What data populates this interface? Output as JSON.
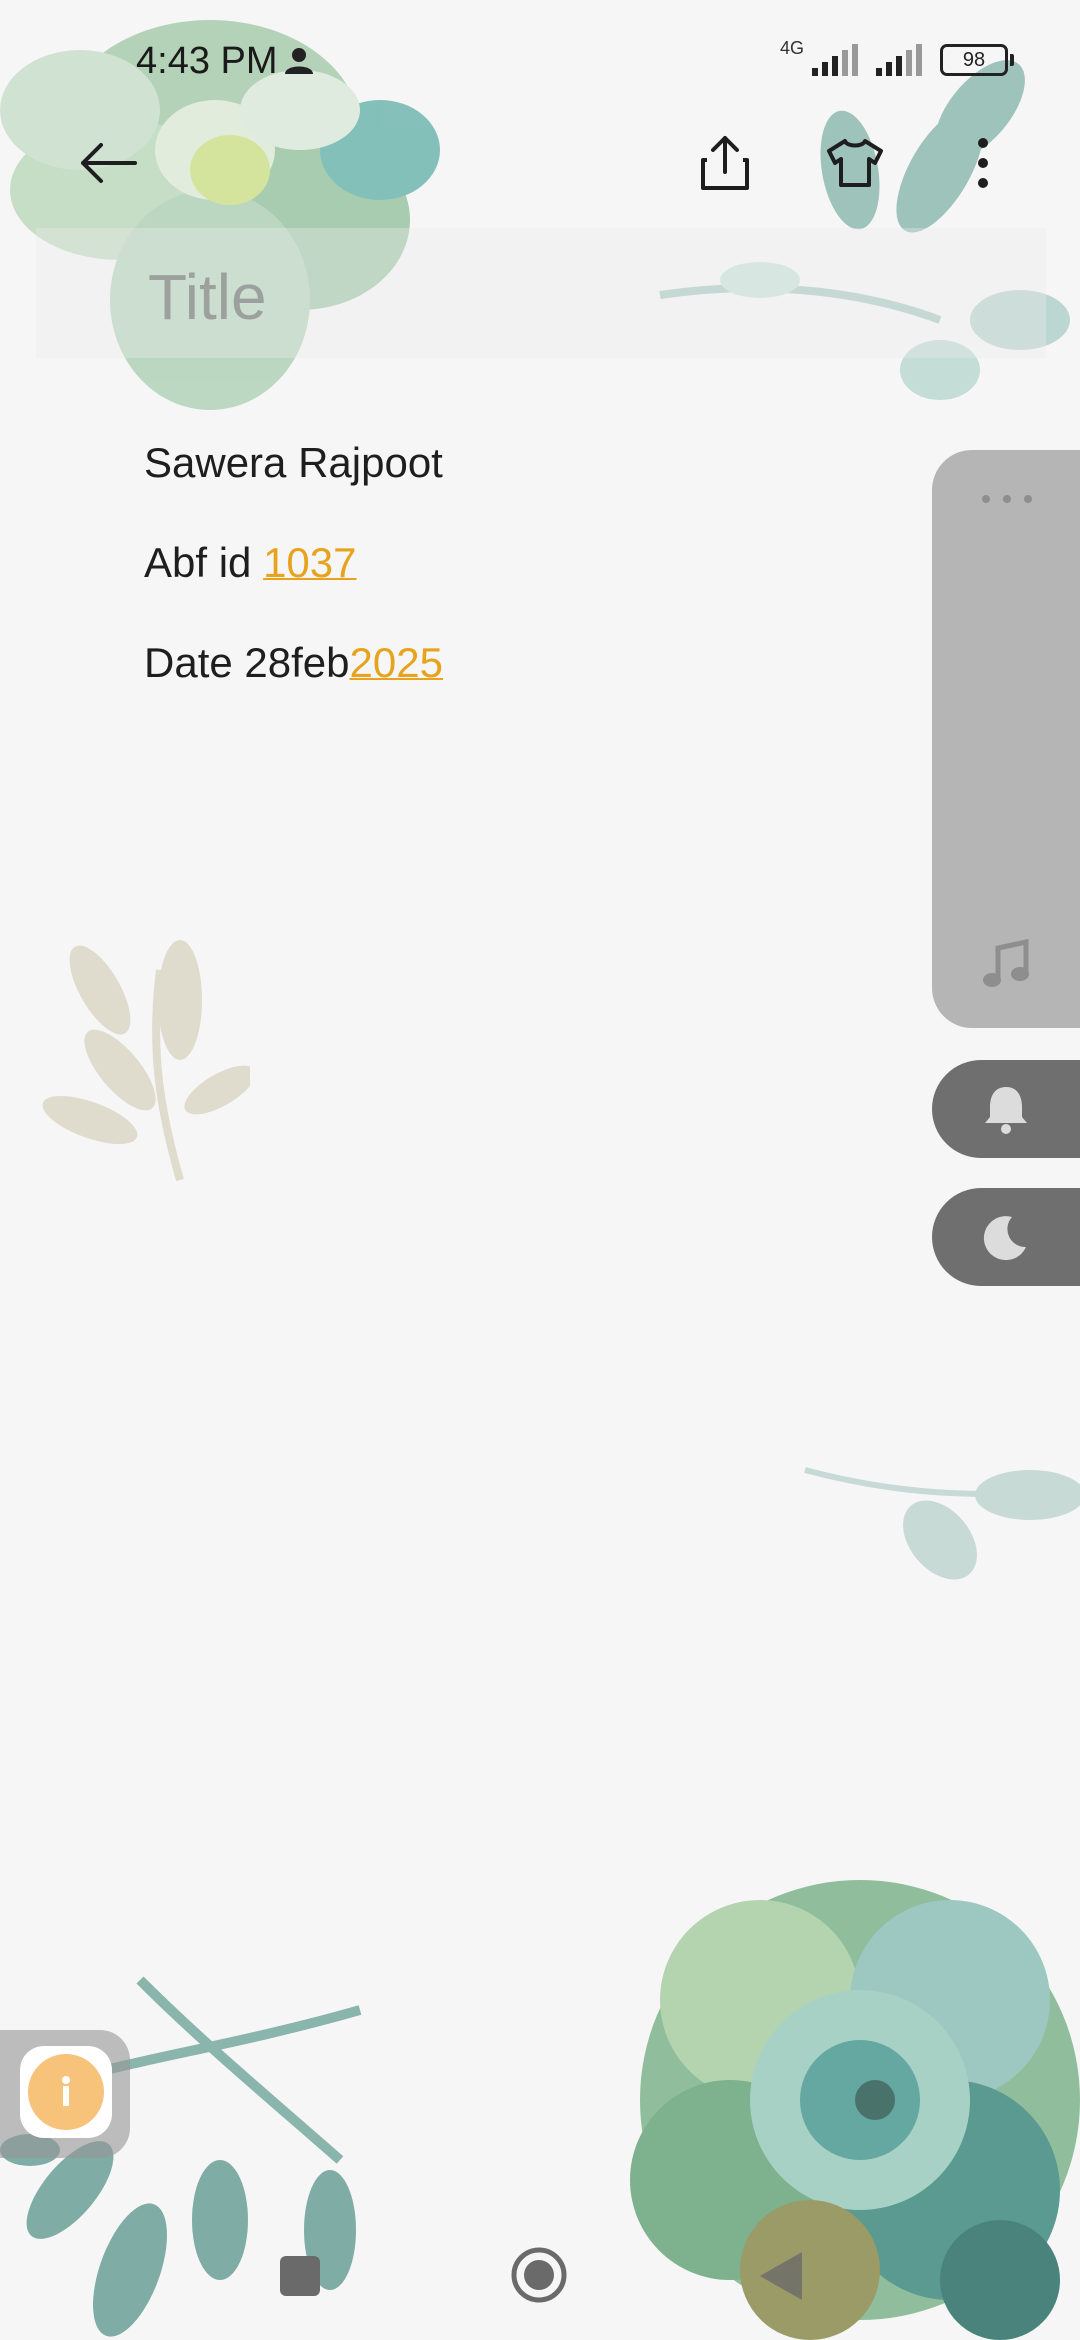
{
  "status_bar": {
    "time": "4:43 PM",
    "network_label": "4G",
    "battery": "98"
  },
  "toolbar": {
    "back_icon": "arrow-left-icon",
    "share_icon": "share-icon",
    "theme_icon": "tshirt-icon",
    "more_icon": "more-vertical-icon"
  },
  "title": {
    "placeholder": "Title",
    "value": ""
  },
  "note": {
    "line1": "Sawera Rajpoot",
    "line2_prefix": "Abf id ",
    "line2_link": "1037",
    "line3_prefix": "Date 28feb",
    "line3_link": "2025"
  },
  "side_panel": {
    "menu_icon": "more-horizontal-icon",
    "music_icon": "music-note-icon",
    "bell_icon": "bell-icon",
    "moon_icon": "moon-icon"
  },
  "colors": {
    "link": "#e7a31d",
    "background": "#f6f6f6",
    "panel": "#b5b5b5",
    "pill": "#6f6f6f"
  }
}
